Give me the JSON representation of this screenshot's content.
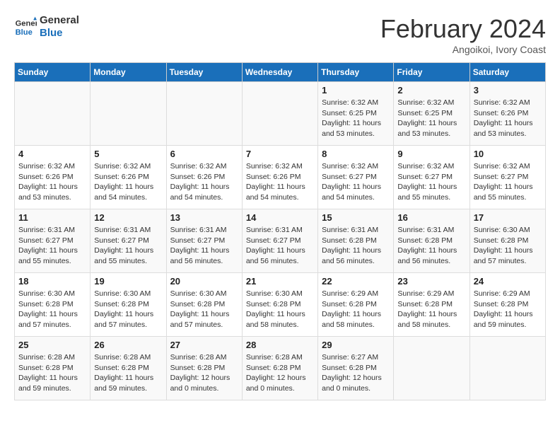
{
  "logo": {
    "line1": "General",
    "line2": "Blue"
  },
  "title": "February 2024",
  "subtitle": "Angoikoi, Ivory Coast",
  "weekdays": [
    "Sunday",
    "Monday",
    "Tuesday",
    "Wednesday",
    "Thursday",
    "Friday",
    "Saturday"
  ],
  "weeks": [
    [
      {
        "day": "",
        "info": ""
      },
      {
        "day": "",
        "info": ""
      },
      {
        "day": "",
        "info": ""
      },
      {
        "day": "",
        "info": ""
      },
      {
        "day": "1",
        "info": "Sunrise: 6:32 AM\nSunset: 6:25 PM\nDaylight: 11 hours\nand 53 minutes."
      },
      {
        "day": "2",
        "info": "Sunrise: 6:32 AM\nSunset: 6:25 PM\nDaylight: 11 hours\nand 53 minutes."
      },
      {
        "day": "3",
        "info": "Sunrise: 6:32 AM\nSunset: 6:26 PM\nDaylight: 11 hours\nand 53 minutes."
      }
    ],
    [
      {
        "day": "4",
        "info": "Sunrise: 6:32 AM\nSunset: 6:26 PM\nDaylight: 11 hours\nand 53 minutes."
      },
      {
        "day": "5",
        "info": "Sunrise: 6:32 AM\nSunset: 6:26 PM\nDaylight: 11 hours\nand 54 minutes."
      },
      {
        "day": "6",
        "info": "Sunrise: 6:32 AM\nSunset: 6:26 PM\nDaylight: 11 hours\nand 54 minutes."
      },
      {
        "day": "7",
        "info": "Sunrise: 6:32 AM\nSunset: 6:26 PM\nDaylight: 11 hours\nand 54 minutes."
      },
      {
        "day": "8",
        "info": "Sunrise: 6:32 AM\nSunset: 6:27 PM\nDaylight: 11 hours\nand 54 minutes."
      },
      {
        "day": "9",
        "info": "Sunrise: 6:32 AM\nSunset: 6:27 PM\nDaylight: 11 hours\nand 55 minutes."
      },
      {
        "day": "10",
        "info": "Sunrise: 6:32 AM\nSunset: 6:27 PM\nDaylight: 11 hours\nand 55 minutes."
      }
    ],
    [
      {
        "day": "11",
        "info": "Sunrise: 6:31 AM\nSunset: 6:27 PM\nDaylight: 11 hours\nand 55 minutes."
      },
      {
        "day": "12",
        "info": "Sunrise: 6:31 AM\nSunset: 6:27 PM\nDaylight: 11 hours\nand 55 minutes."
      },
      {
        "day": "13",
        "info": "Sunrise: 6:31 AM\nSunset: 6:27 PM\nDaylight: 11 hours\nand 56 minutes."
      },
      {
        "day": "14",
        "info": "Sunrise: 6:31 AM\nSunset: 6:27 PM\nDaylight: 11 hours\nand 56 minutes."
      },
      {
        "day": "15",
        "info": "Sunrise: 6:31 AM\nSunset: 6:28 PM\nDaylight: 11 hours\nand 56 minutes."
      },
      {
        "day": "16",
        "info": "Sunrise: 6:31 AM\nSunset: 6:28 PM\nDaylight: 11 hours\nand 56 minutes."
      },
      {
        "day": "17",
        "info": "Sunrise: 6:30 AM\nSunset: 6:28 PM\nDaylight: 11 hours\nand 57 minutes."
      }
    ],
    [
      {
        "day": "18",
        "info": "Sunrise: 6:30 AM\nSunset: 6:28 PM\nDaylight: 11 hours\nand 57 minutes."
      },
      {
        "day": "19",
        "info": "Sunrise: 6:30 AM\nSunset: 6:28 PM\nDaylight: 11 hours\nand 57 minutes."
      },
      {
        "day": "20",
        "info": "Sunrise: 6:30 AM\nSunset: 6:28 PM\nDaylight: 11 hours\nand 57 minutes."
      },
      {
        "day": "21",
        "info": "Sunrise: 6:30 AM\nSunset: 6:28 PM\nDaylight: 11 hours\nand 58 minutes."
      },
      {
        "day": "22",
        "info": "Sunrise: 6:29 AM\nSunset: 6:28 PM\nDaylight: 11 hours\nand 58 minutes."
      },
      {
        "day": "23",
        "info": "Sunrise: 6:29 AM\nSunset: 6:28 PM\nDaylight: 11 hours\nand 58 minutes."
      },
      {
        "day": "24",
        "info": "Sunrise: 6:29 AM\nSunset: 6:28 PM\nDaylight: 11 hours\nand 59 minutes."
      }
    ],
    [
      {
        "day": "25",
        "info": "Sunrise: 6:28 AM\nSunset: 6:28 PM\nDaylight: 11 hours\nand 59 minutes."
      },
      {
        "day": "26",
        "info": "Sunrise: 6:28 AM\nSunset: 6:28 PM\nDaylight: 11 hours\nand 59 minutes."
      },
      {
        "day": "27",
        "info": "Sunrise: 6:28 AM\nSunset: 6:28 PM\nDaylight: 12 hours\nand 0 minutes."
      },
      {
        "day": "28",
        "info": "Sunrise: 6:28 AM\nSunset: 6:28 PM\nDaylight: 12 hours\nand 0 minutes."
      },
      {
        "day": "29",
        "info": "Sunrise: 6:27 AM\nSunset: 6:28 PM\nDaylight: 12 hours\nand 0 minutes."
      },
      {
        "day": "",
        "info": ""
      },
      {
        "day": "",
        "info": ""
      }
    ]
  ]
}
